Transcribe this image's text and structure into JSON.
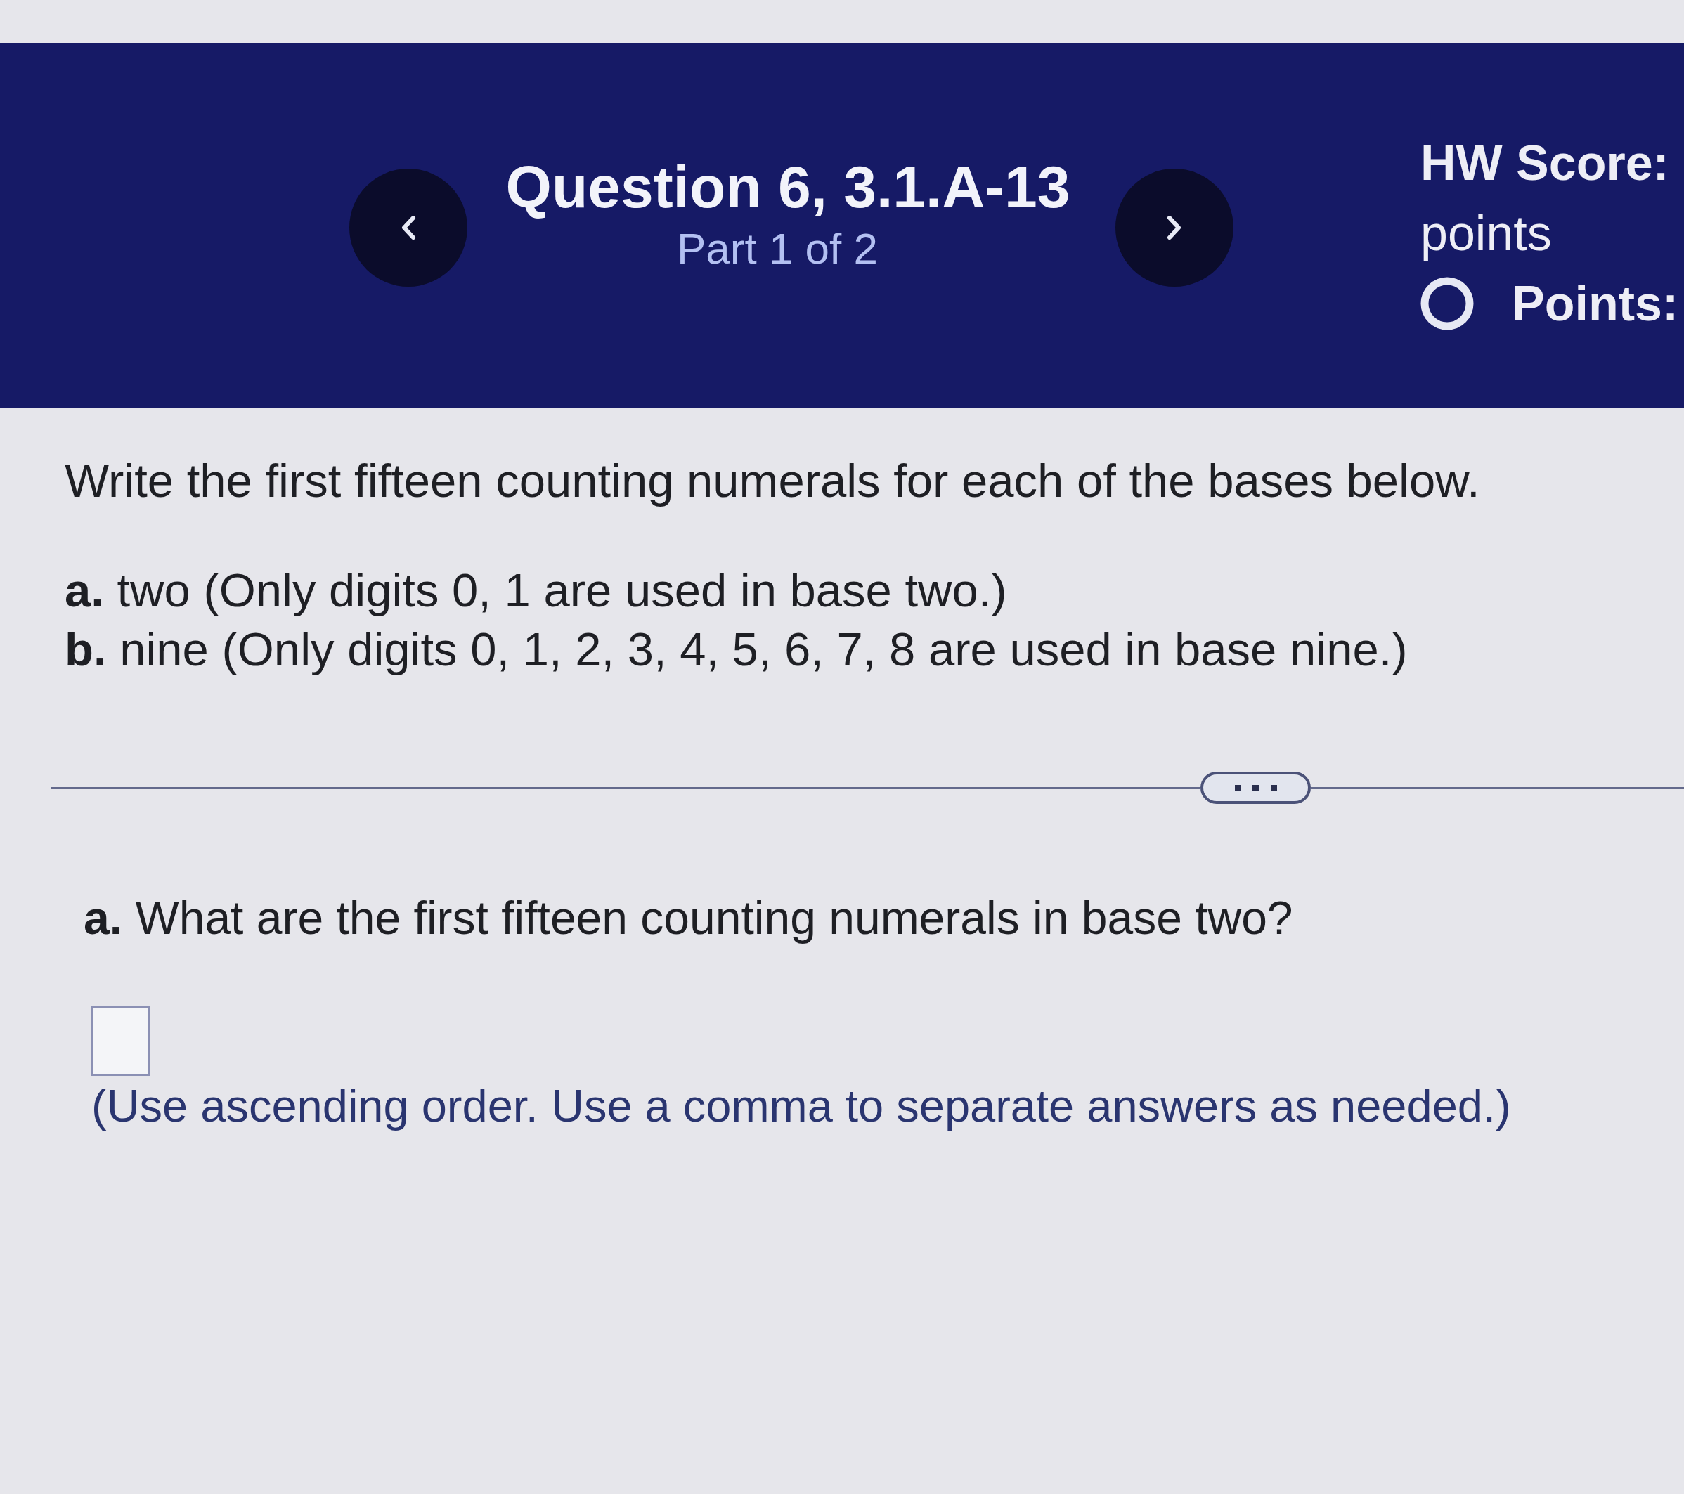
{
  "header": {
    "title": "Question 6, 3.1.A-13",
    "subtitle": "Part 1 of 2",
    "score_label": "HW Score:",
    "score_unit": "points",
    "points_label": "Points:"
  },
  "question": {
    "instruction": "Write the first fifteen counting numerals for each of the bases below.",
    "parts": [
      "**a.** two (Only digits 0, 1 are used in base two.)",
      "**b.** nine (Only digits 0, 1, 2, 3, 4, 5, 6, 7, 8 are used in base nine.)"
    ]
  },
  "answer": {
    "prompt": "**a.** What are the first fifteen counting numerals in base two?",
    "hint": "(Use ascending order. Use a comma to separate answers as needed.)"
  }
}
